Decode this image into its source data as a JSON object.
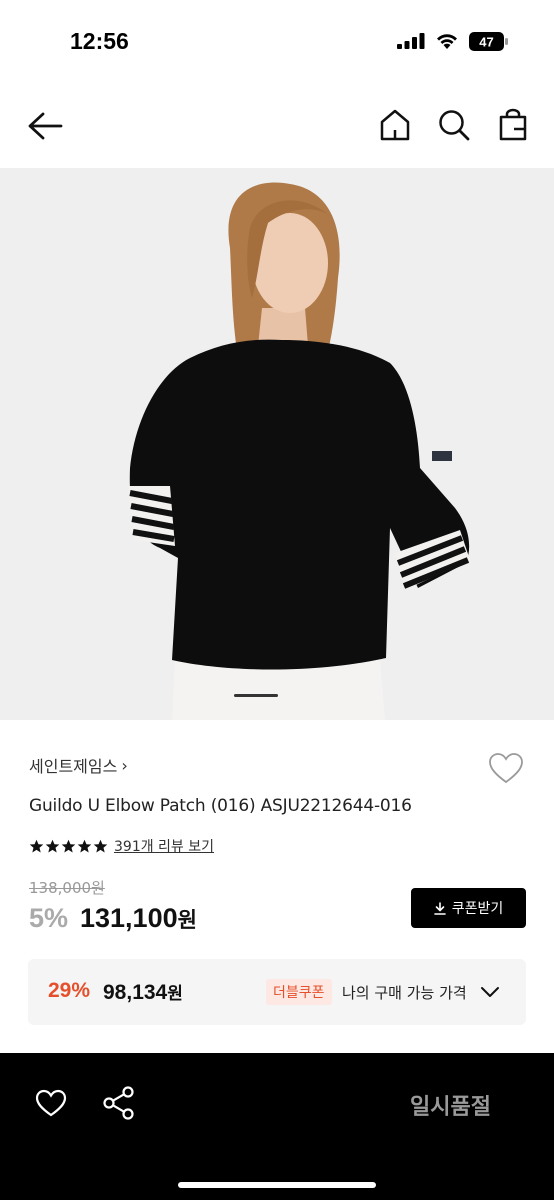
{
  "status_bar": {
    "time": "12:56",
    "battery": "47"
  },
  "nav": {
    "back_icon": "arrow-left-icon",
    "home_icon": "home-icon",
    "search_icon": "search-icon",
    "bag_icon": "shopping-bag-icon"
  },
  "gallery": {
    "image_alt": "product-photo",
    "slide_current": 1
  },
  "product": {
    "brand": "세인트제임스",
    "brand_chevron": "›",
    "name": "Guildo U Elbow Patch (016) ASJU2212644-016",
    "rating_stars": 5,
    "review_link": "391개 리뷰 보기",
    "original_price": "138,000원",
    "discount_rate": "5%",
    "sale_price": "131,100",
    "sale_unit": "원",
    "coupon_button": "쿠폰받기"
  },
  "best_price": {
    "rate": "29%",
    "price": "98,134",
    "unit": "원",
    "coupon_badge": "더블쿠폰",
    "label": "나의 구매 가능 가격"
  },
  "bottom_bar": {
    "soldout_label": "일시품절"
  },
  "colors": {
    "accent": "#e5502b",
    "black": "#000000",
    "gray_text": "#999999"
  }
}
